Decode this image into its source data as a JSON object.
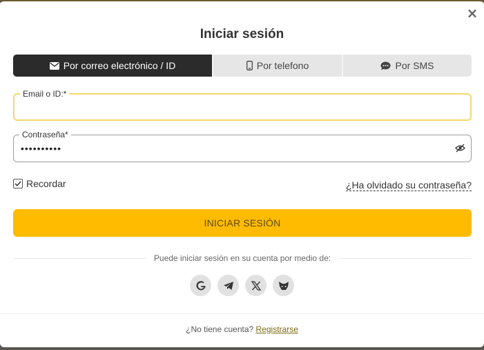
{
  "modal": {
    "title": "Iniciar sesión",
    "close_symbol": "×"
  },
  "tabs": [
    {
      "label": "Por correo electrónico / ID",
      "icon": "envelope-icon",
      "active": true
    },
    {
      "label": "Por telefono",
      "icon": "phone-icon",
      "active": false
    },
    {
      "label": "Por SMS",
      "icon": "chat-icon",
      "active": false
    }
  ],
  "email_field": {
    "label": "Email o ID:*",
    "value": "",
    "placeholder": ""
  },
  "password_field": {
    "label": "Contraseña*",
    "value": "••••••••••",
    "placeholder": ""
  },
  "remember": {
    "label": "Recordar",
    "checked": true
  },
  "forgot_link": "¿Ha olvidado su contraseña?",
  "login_button": "INICIAR SESIÓN",
  "social": {
    "prompt": "Puede iniciar sesión en su cuenta por medio de:",
    "providers": [
      "google-icon",
      "telegram-icon",
      "x-icon",
      "metamask-icon"
    ]
  },
  "footer": {
    "text": "¿No tiene cuenta?",
    "link": "Registrarse"
  },
  "colors": {
    "accent": "#ffbb00",
    "active_tab": "#2b2b2b",
    "focus_border": "#f3d86a"
  }
}
